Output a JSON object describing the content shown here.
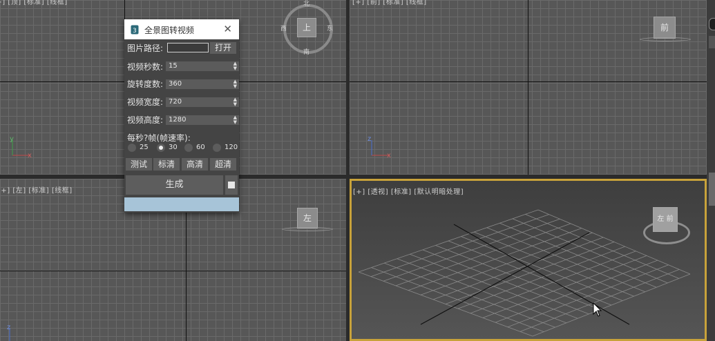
{
  "viewports": {
    "top_left": {
      "label": "[+] [顶] [标准] [线框]",
      "compass": {
        "north": "北",
        "south": "南",
        "east": "东",
        "west": "西"
      },
      "cube_face": "上"
    },
    "top_right": {
      "label": "[+] [前] [标准] [线框]",
      "cube_face": "前"
    },
    "bottom_left": {
      "label": "[+] [左] [标准] [线框]",
      "cube_face": "左"
    },
    "bottom_right": {
      "label": "[+] [透视] [标准] [默认明暗处理]",
      "cube_face": "左  前"
    }
  },
  "axes": {
    "x": "x",
    "y": "y",
    "z": "z"
  },
  "dialog": {
    "title": "全景图转视频",
    "path_label": "图片路径:",
    "path_value": "",
    "open_button": "打开",
    "fields": [
      {
        "label": "视频秒数:",
        "value": "15"
      },
      {
        "label": "旋转度数:",
        "value": "360"
      },
      {
        "label": "视频宽度:",
        "value": "720"
      },
      {
        "label": "视频高度:",
        "value": "1280"
      }
    ],
    "fps_label": "每秒?帧(帧速率):",
    "fps_options": [
      "25",
      "30",
      "60",
      "120"
    ],
    "fps_selected": "30",
    "quality_buttons": [
      "测试",
      "标清",
      "高清",
      "超清"
    ],
    "generate_button": "生成",
    "progress": 1.0
  },
  "colors": {
    "progress_fill": "#a7c4d8",
    "active_border": "#c8a23a",
    "dialog_bg": "#444444"
  }
}
